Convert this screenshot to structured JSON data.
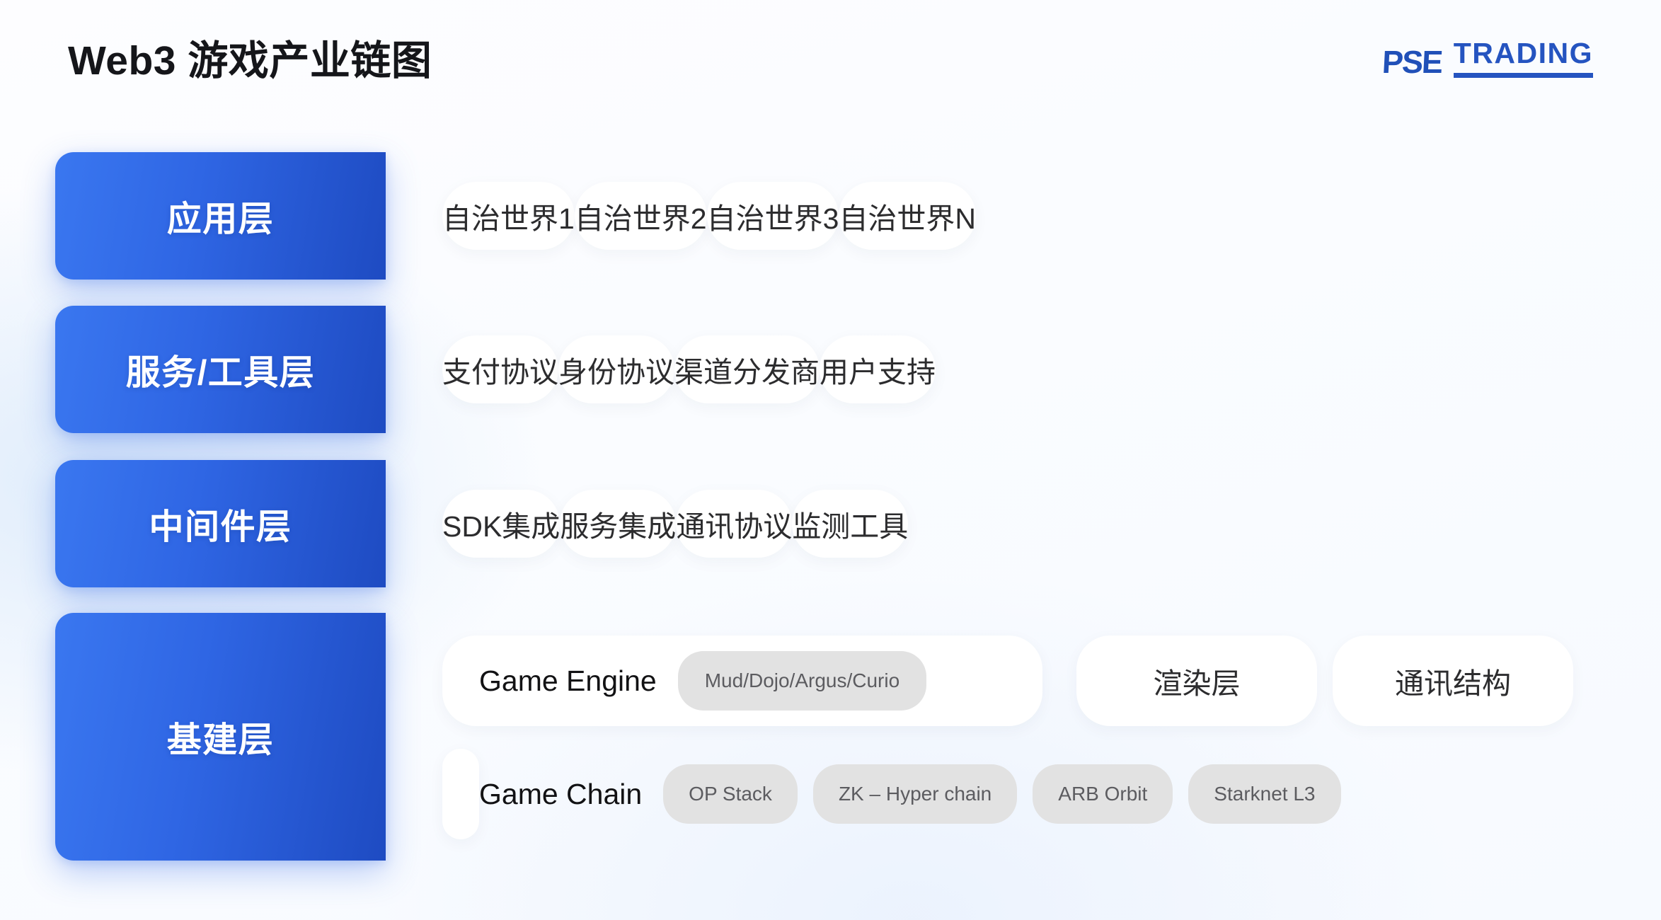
{
  "header": {
    "title": "Web3 游戏产业链图",
    "logo_primary": "PSE",
    "logo_secondary": "TRADING"
  },
  "colors": {
    "brand_blue": "#2554c0",
    "layer_gradient_start": "#3a77f0",
    "layer_gradient_end": "#1e4bc2",
    "band_gray": "#f1f1f1",
    "card_white": "#ffffff",
    "chip_gray": "#e2e2e2",
    "title_black": "#15161a"
  },
  "layers": [
    {
      "label": "应用层",
      "items": [
        "自治世界1",
        "自治世界2",
        "自治世界3",
        "自治世界N"
      ]
    },
    {
      "label": "服务/工具层",
      "items": [
        "支付协议",
        "身份协议",
        "渠道分发商",
        "用户支持"
      ]
    },
    {
      "label": "中间件层",
      "items": [
        "SDK集成",
        "服务集成",
        "通讯协议",
        "监测工具"
      ]
    },
    {
      "label": "基建层",
      "engine_title": "Game Engine",
      "engine_chip": "Mud/Dojo/Argus/Curio",
      "render_item": "渲染层",
      "comm_item": "通讯结构",
      "chain_title": "Game Chain",
      "chain_chips": [
        "OP Stack",
        "ZK – Hyper chain",
        "ARB Orbit",
        "Starknet L3"
      ]
    }
  ]
}
